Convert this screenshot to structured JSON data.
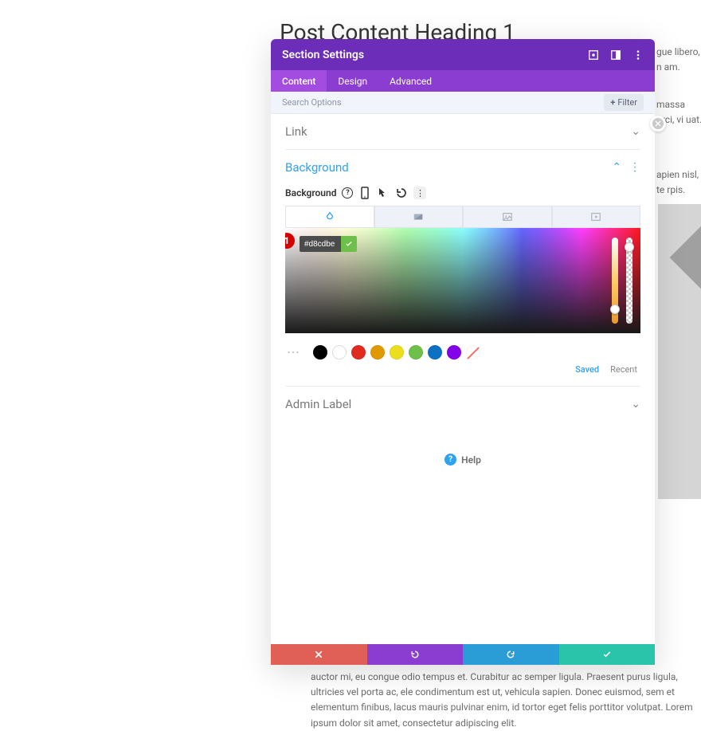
{
  "page": {
    "heading": "Post Content Heading 1",
    "bg_text_1": "gue libero, n\nam.",
    "bg_text_2": "massa orci, vi\nuat.",
    "bg_text_3": "apien nisl, te\nrpis.",
    "bg_text_4": "auctor mi, eu congue odio tempus et. Curabitur ac semper ligula. Praesent purus ligula, ultricies vel porta ac, ele condimentum est ut, vehicula sapien. Donec euismod, sem et elementum finibus, lacus mauris pulvinar enim, id tortor eget felis porttitor volutpat. Lorem ipsum dolor sit amet, consectetur adipiscing elit."
  },
  "modal": {
    "title": "Section Settings",
    "tabs": {
      "content": "Content",
      "design": "Design",
      "advanced": "Advanced"
    },
    "search": {
      "placeholder": "Search Options",
      "filter_label": "Filter"
    },
    "sections": {
      "link": "Link",
      "background": "Background",
      "background_field_label": "Background",
      "admin_label": "Admin Label",
      "help": "Help"
    },
    "color": {
      "hex": "#d8cdbe",
      "annotation": "1",
      "swatches": [
        "#000000",
        "#ffffff",
        "#e02b20",
        "#e09900",
        "#ebde1d",
        "#6fbf4b",
        "#0c71c3",
        "#8300e9"
      ],
      "saved_label": "Saved",
      "recent_label": "Recent"
    }
  }
}
